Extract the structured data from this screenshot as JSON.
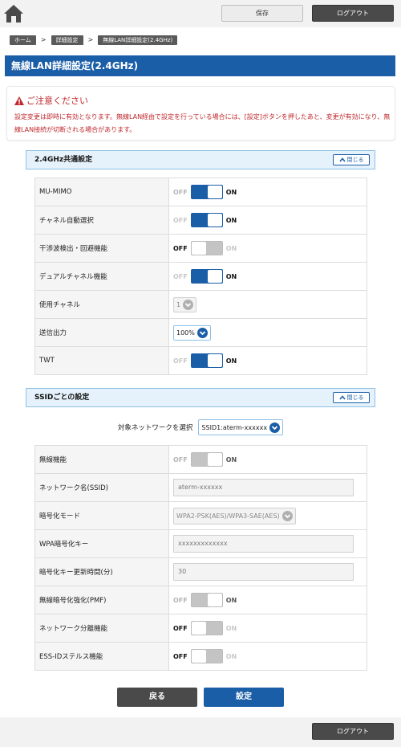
{
  "header": {
    "home_icon": "home-icon",
    "save_label": "保存",
    "logout_label": "ログアウト"
  },
  "breadcrumb": [
    "ホーム",
    "詳細設定",
    "無線LAN詳細設定(2.4GHz)"
  ],
  "page_title": "無線LAN詳細設定(2.4GHz)",
  "caution": {
    "title": "ご注意ください",
    "icon": "warning-icon",
    "text": "設定変更は即時に有効となります。無線LAN経由で設定を行っている場合には、[設定]ボタンを押したあと、変更が有効になり、無線LAN接続が切断される場合があります。"
  },
  "common_section": {
    "title": "2.4GHz共通設定",
    "collapse_label": "閉じる",
    "rows": [
      {
        "label": "MU-MIMO",
        "off": "OFF",
        "on": "ON",
        "state": "on"
      },
      {
        "label": "チャネル自動選択",
        "off": "OFF",
        "on": "ON",
        "state": "on"
      },
      {
        "label": "干渉波検出・回避機能",
        "off": "OFF",
        "on": "ON",
        "state": "off"
      },
      {
        "label": "デュアルチャネル機能",
        "off": "OFF",
        "on": "ON",
        "state": "on"
      },
      {
        "label": "使用チャネル",
        "value": "1"
      },
      {
        "label": "送信出力",
        "value": "100%"
      },
      {
        "label": "TWT",
        "off": "OFF",
        "on": "ON",
        "state": "on"
      }
    ]
  },
  "ssid_section": {
    "title": "SSIDごとの設定",
    "collapse_label": "閉じる",
    "network_select_label": "対象ネットワークを選択",
    "network_select_value": "SSID1:aterm-xxxxxx",
    "rows": [
      {
        "label": "無線機能",
        "off": "OFF",
        "on": "ON",
        "state": "on"
      },
      {
        "label": "ネットワーク名(SSID)",
        "value": "aterm-xxxxxx"
      },
      {
        "label": "暗号化モード",
        "value": "WPA2-PSK(AES)/WPA3-SAE(AES)"
      },
      {
        "label": "WPA暗号化キー",
        "value": "xxxxxxxxxxxxx"
      },
      {
        "label": "暗号化キー更新時間(分)",
        "value": "30"
      },
      {
        "label": "無線暗号化強化(PMF)",
        "off": "OFF",
        "on": "ON",
        "state": "on"
      },
      {
        "label": "ネットワーク分離機能",
        "off": "OFF",
        "on": "ON",
        "state": "off"
      },
      {
        "label": "ESS-IDステルス機能",
        "off": "OFF",
        "on": "ON",
        "state": "off"
      }
    ]
  },
  "actions": {
    "back_label": "戻る",
    "set_label": "設定"
  },
  "footer": {
    "logout_label": "ログアウト"
  },
  "colors": {
    "primary": "#1a5ea8",
    "caution": "#c0282d",
    "dark_button": "#4a4a4a",
    "section_bg": "#e6f2fb"
  }
}
